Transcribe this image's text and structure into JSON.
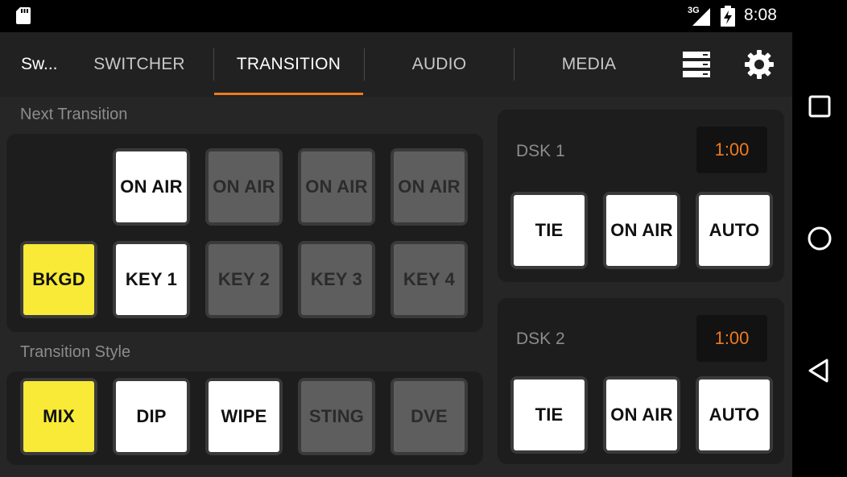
{
  "status_bar": {
    "time": "8:08",
    "network": "3G",
    "icons": [
      "sd-card-icon",
      "signal-icon",
      "battery-icon"
    ]
  },
  "toolbar": {
    "app_title": "Sw...",
    "tabs": [
      {
        "label": "SWITCHER",
        "active": false
      },
      {
        "label": "TRANSITION",
        "active": true
      },
      {
        "label": "AUDIO",
        "active": false
      },
      {
        "label": "MEDIA",
        "active": false
      }
    ],
    "icons": [
      "menu-list-icon",
      "settings-gear-icon"
    ],
    "accent_color": "#f07a1e"
  },
  "next_transition": {
    "label": "Next Transition",
    "on_air_row": [
      {
        "label": "ON AIR",
        "state": "white"
      },
      {
        "label": "ON AIR",
        "state": "gray"
      },
      {
        "label": "ON AIR",
        "state": "gray"
      },
      {
        "label": "ON AIR",
        "state": "gray"
      }
    ],
    "key_row": [
      {
        "label": "BKGD",
        "state": "yellow"
      },
      {
        "label": "KEY 1",
        "state": "white"
      },
      {
        "label": "KEY 2",
        "state": "gray"
      },
      {
        "label": "KEY 3",
        "state": "gray"
      },
      {
        "label": "KEY 4",
        "state": "gray"
      }
    ]
  },
  "transition_style": {
    "label": "Transition Style",
    "buttons": [
      {
        "label": "MIX",
        "state": "yellow"
      },
      {
        "label": "DIP",
        "state": "white"
      },
      {
        "label": "WIPE",
        "state": "white"
      },
      {
        "label": "STING",
        "state": "gray"
      },
      {
        "label": "DVE",
        "state": "gray"
      }
    ]
  },
  "dsk1": {
    "label": "DSK 1",
    "time": "1:00",
    "buttons": [
      {
        "label": "TIE",
        "state": "white"
      },
      {
        "label": "ON AIR",
        "state": "white"
      },
      {
        "label": "AUTO",
        "state": "white"
      }
    ]
  },
  "dsk2": {
    "label": "DSK 2",
    "time": "1:00",
    "buttons": [
      {
        "label": "TIE",
        "state": "white"
      },
      {
        "label": "ON AIR",
        "state": "white"
      },
      {
        "label": "AUTO",
        "state": "white"
      }
    ]
  },
  "nav_bar": {
    "icons": [
      "recents-square-icon",
      "home-circle-icon",
      "back-triangle-icon"
    ]
  },
  "colors": {
    "button_active_yellow": "#f8ea36",
    "button_white": "#ffffff",
    "button_inactive_gray": "#5e5e5e",
    "timer_text": "#f07a1e"
  }
}
